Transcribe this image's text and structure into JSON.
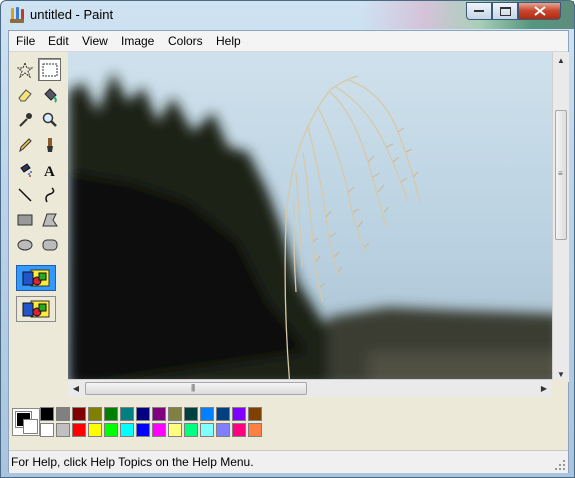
{
  "window": {
    "title": "untitled - Paint"
  },
  "menu": [
    "File",
    "Edit",
    "View",
    "Image",
    "Colors",
    "Help"
  ],
  "status": {
    "text": "For Help, click Help Topics on the Help Menu."
  },
  "palette": {
    "top": [
      "#000000",
      "#808080",
      "#800000",
      "#808000",
      "#008000",
      "#008080",
      "#000080",
      "#800080",
      "#808040",
      "#004040",
      "#0080ff",
      "#004080",
      "#8000ff",
      "#804000"
    ],
    "bottom": [
      "#ffffff",
      "#c0c0c0",
      "#ff0000",
      "#ffff00",
      "#00ff00",
      "#00ffff",
      "#0000ff",
      "#ff00ff",
      "#ffff80",
      "#00ff80",
      "#80ffff",
      "#8080ff",
      "#ff0080",
      "#ff8040"
    ]
  },
  "tools": [
    "free-select",
    "rect-select",
    "eraser",
    "fill",
    "color-picker",
    "magnifier",
    "pencil",
    "brush",
    "airbrush",
    "text",
    "line",
    "curve",
    "rectangle",
    "polygon",
    "ellipse",
    "rounded-rect"
  ],
  "colors": {
    "accent": "#3399ff",
    "window_frame": "#bcd4ea"
  }
}
